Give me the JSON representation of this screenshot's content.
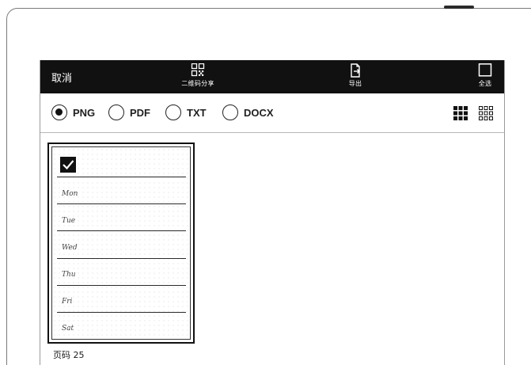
{
  "toolbar": {
    "cancel_label": "取消",
    "share_label": "二维码分享",
    "share_icon": "qr-code-icon",
    "export_label": "导出",
    "export_icon": "export-icon",
    "select_all_label": "全选",
    "select_all_icon": "checkbox-outline-icon"
  },
  "formats": {
    "options": [
      "PNG",
      "PDF",
      "TXT",
      "DOCX"
    ],
    "selected": "PNG"
  },
  "view_modes": {
    "options": [
      "large-grid",
      "small-grid"
    ],
    "selected": "large-grid"
  },
  "pages": [
    {
      "page_label": "页码 25",
      "selected": true,
      "lines": [
        "",
        "Mon",
        "Tue",
        "Wed",
        "Thu",
        "Fri",
        "Sat"
      ]
    }
  ],
  "colors": {
    "toolbar_bg": "#111111",
    "toolbar_text": "#ffffff",
    "page_bg": "#ffffff"
  }
}
